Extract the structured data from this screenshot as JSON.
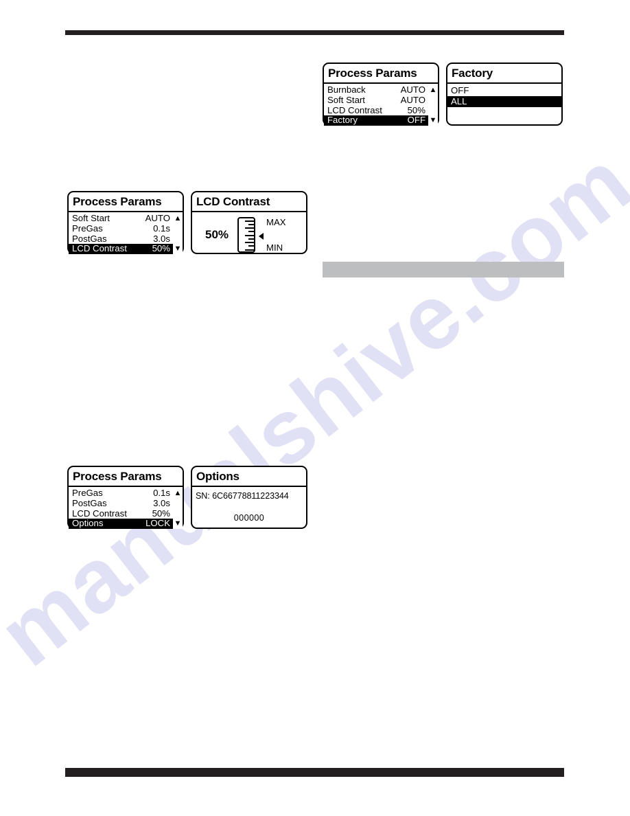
{
  "page": {
    "watermark": "manualshive.com",
    "rules": {
      "top_label": "top-black-rule",
      "bottom_label": "bottom-black-rule",
      "gray_label": "gray-section-bar"
    }
  },
  "panels": {
    "process_params_factory": {
      "title": "Process Params",
      "rows": [
        {
          "label": "Burnback",
          "value": "AUTO",
          "arrow": "▲",
          "selected": false
        },
        {
          "label": "Soft Start",
          "value": "AUTO",
          "arrow": "",
          "selected": false
        },
        {
          "label": "LCD Contrast",
          "value": "50%",
          "arrow": "",
          "selected": false
        },
        {
          "label": "Factory",
          "value": "OFF",
          "arrow": "▼",
          "selected": true
        }
      ]
    },
    "factory": {
      "title": "Factory",
      "options": [
        {
          "label": "OFF",
          "selected": false
        },
        {
          "label": "ALL",
          "selected": true
        }
      ]
    },
    "process_params_contrast": {
      "title": "Process Params",
      "rows": [
        {
          "label": "Soft Start",
          "value": "AUTO",
          "arrow": "▲",
          "selected": false
        },
        {
          "label": "PreGas",
          "value": "0.1s",
          "arrow": "",
          "selected": false
        },
        {
          "label": "PostGas",
          "value": "3.0s",
          "arrow": "",
          "selected": false
        },
        {
          "label": "LCD Contrast",
          "value": "50%",
          "arrow": "▼",
          "selected": true
        }
      ]
    },
    "lcd_contrast": {
      "title": "LCD Contrast",
      "percent": "50%",
      "max_label": "MAX",
      "min_label": "MIN"
    },
    "process_params_options": {
      "title": "Process Params",
      "rows": [
        {
          "label": "PreGas",
          "value": "0.1s",
          "arrow": "▲",
          "selected": false
        },
        {
          "label": "PostGas",
          "value": "3.0s",
          "arrow": "",
          "selected": false
        },
        {
          "label": "LCD Contrast",
          "value": "50%",
          "arrow": "",
          "selected": false
        },
        {
          "label": "Options",
          "value": "LOCK",
          "arrow": "▼",
          "selected": true
        }
      ]
    },
    "options": {
      "title": "Options",
      "serial": "SN: 6C66778811223344",
      "code": "000000"
    }
  },
  "colors": {
    "rule_black": "#231f20",
    "rule_gray": "#bcbec0",
    "highlight": "#000000",
    "watermark": "#c9c9ee"
  }
}
